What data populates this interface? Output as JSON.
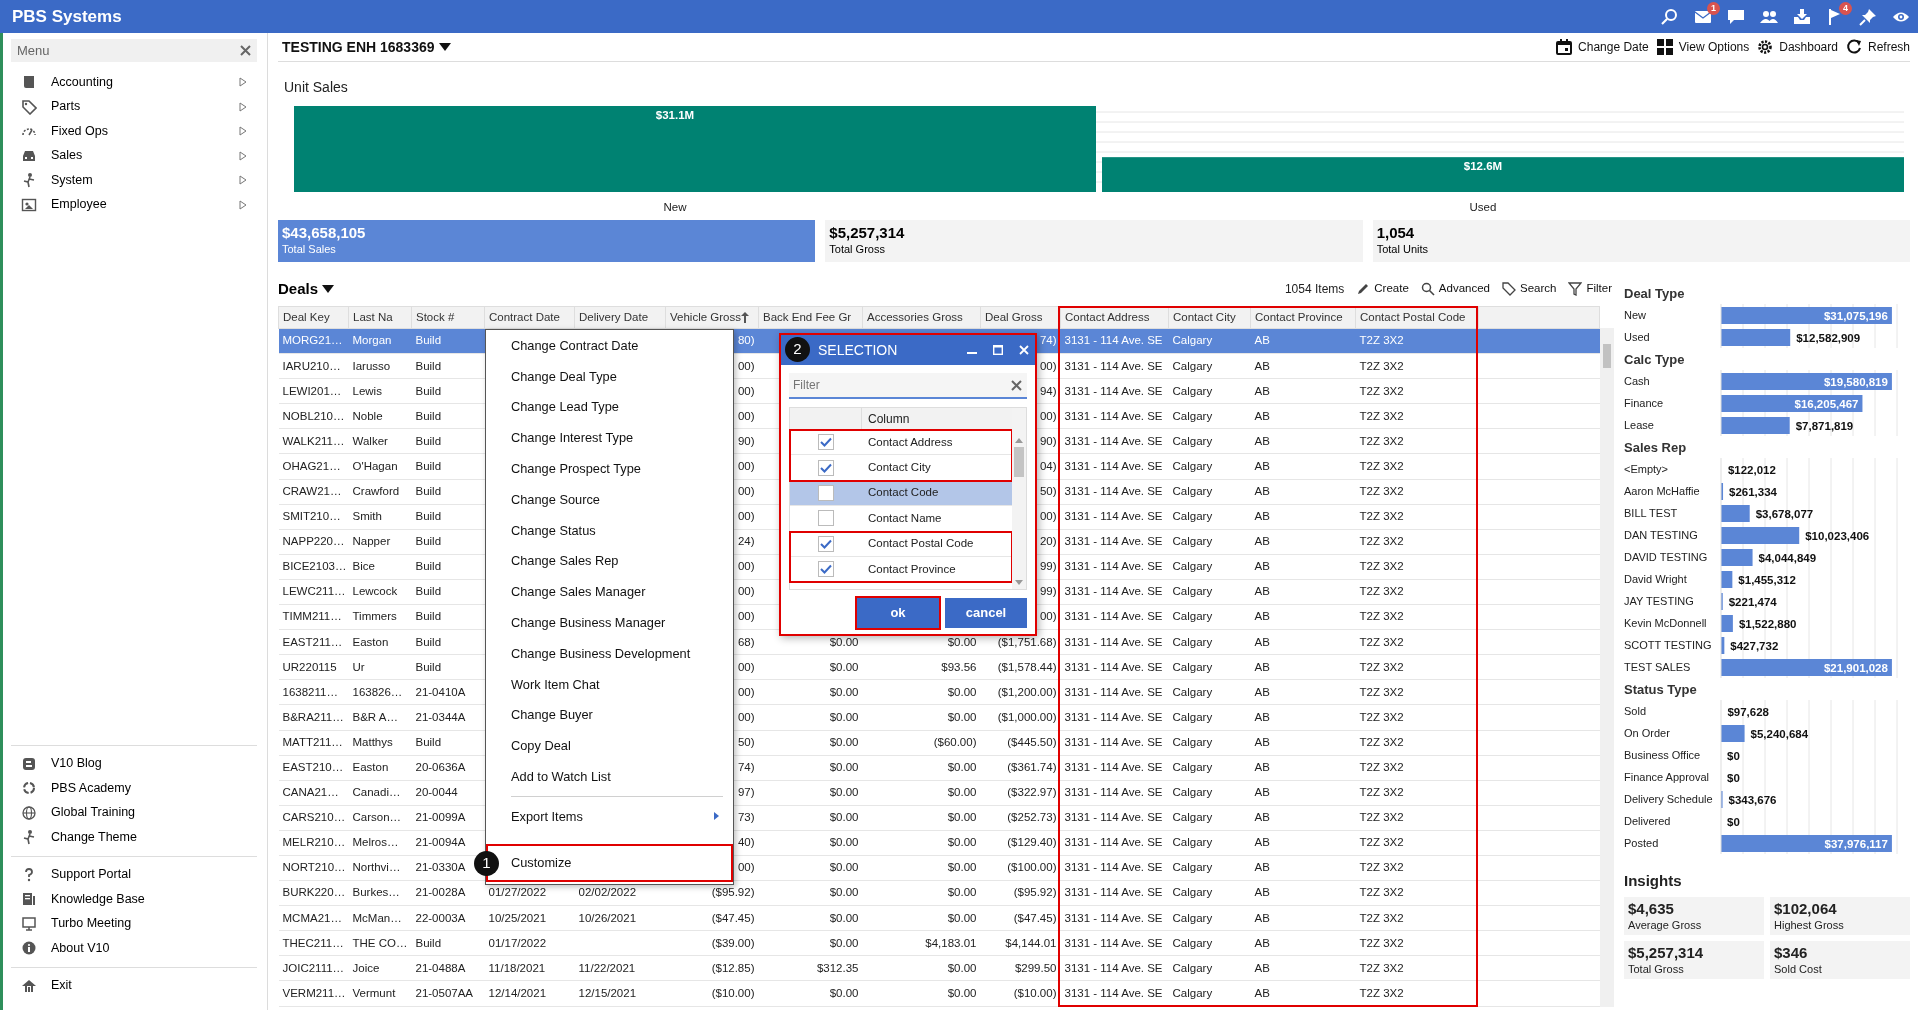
{
  "app": {
    "title": "PBS Systems",
    "mail_badge": "1",
    "flag_badge": "4"
  },
  "sidebar": {
    "header": "Menu",
    "items": [
      {
        "label": "Accounting"
      },
      {
        "label": "Parts"
      },
      {
        "label": "Fixed Ops"
      },
      {
        "label": "Sales"
      },
      {
        "label": "System"
      },
      {
        "label": "Employee"
      }
    ],
    "link_groups": [
      [
        "V10 Blog",
        "PBS Academy",
        "Global Training",
        "Change Theme"
      ],
      [
        "Support Portal",
        "Knowledge Base",
        "Turbo Meeting",
        "About V10"
      ],
      [
        "Exit"
      ]
    ]
  },
  "toolbar": {
    "title": "TESTING ENH 1683369",
    "actions": [
      "Change Date",
      "View Options",
      "Dashboard",
      "Refresh"
    ]
  },
  "unit_sales": {
    "title": "Unit Sales",
    "chart_data": {
      "type": "bar",
      "categories": [
        "New",
        "Used"
      ],
      "values": [
        31.1,
        12.6
      ],
      "value_labels": [
        "$31.1M",
        "$12.6M"
      ],
      "color": "#008272"
    }
  },
  "summary_tiles": [
    {
      "value": "$43,658,105",
      "label": "Total Sales",
      "selected": true
    },
    {
      "value": "$5,257,314",
      "label": "Total Gross",
      "selected": false
    },
    {
      "value": "1,054",
      "label": "Total Units",
      "selected": false
    }
  ],
  "deals": {
    "title": "Deals",
    "count": "1054 Items",
    "actions": [
      "Create",
      "Advanced",
      "Search",
      "Filter"
    ],
    "columns": [
      {
        "label": "Deal Key",
        "sorted": false,
        "highlighted": false
      },
      {
        "label": "Last Na",
        "sorted": false,
        "highlighted": false
      },
      {
        "label": "Stock #",
        "sorted": false,
        "highlighted": false
      },
      {
        "label": "Contract Date",
        "sorted": false,
        "highlighted": false
      },
      {
        "label": "Delivery Date",
        "sorted": false,
        "highlighted": false
      },
      {
        "label": "Vehicle Gross",
        "sorted": true,
        "highlighted": false
      },
      {
        "label": "Back End Fee Gr",
        "sorted": false,
        "highlighted": false
      },
      {
        "label": "Accessories Gross",
        "sorted": false,
        "highlighted": false
      },
      {
        "label": "Deal Gross",
        "sorted": false,
        "highlighted": false
      },
      {
        "label": "Contact Address",
        "sorted": false,
        "highlighted": true
      },
      {
        "label": "Contact City",
        "sorted": false,
        "highlighted": true
      },
      {
        "label": "Contact Province",
        "sorted": false,
        "highlighted": true
      },
      {
        "label": "Contact Postal Code",
        "sorted": false,
        "highlighted": true
      }
    ],
    "rows": [
      {
        "selected": true,
        "cells": [
          "MORG21…",
          "Morgan",
          "Build",
          null,
          null,
          "80)",
          null,
          null,
          "74)",
          "3131 - 114 Ave. SE",
          "Calgary",
          "AB",
          "T2Z 3X2"
        ]
      },
      {
        "selected": false,
        "cells": [
          "IARU210…",
          "Iarusso",
          "Build",
          null,
          null,
          "00)",
          null,
          null,
          "00)",
          "3131 - 114 Ave. SE",
          "Calgary",
          "AB",
          "T2Z 3X2"
        ]
      },
      {
        "selected": false,
        "cells": [
          "LEWI201…",
          "Lewis",
          "Build",
          null,
          null,
          "00)",
          null,
          null,
          "94)",
          "3131 - 114 Ave. SE",
          "Calgary",
          "AB",
          "T2Z 3X2"
        ]
      },
      {
        "selected": false,
        "cells": [
          "NOBL210…",
          "Noble",
          "Build",
          null,
          null,
          "00)",
          null,
          null,
          "00)",
          "3131 - 114 Ave. SE",
          "Calgary",
          "AB",
          "T2Z 3X2"
        ]
      },
      {
        "selected": false,
        "cells": [
          "WALK211…",
          "Walker",
          "Build",
          null,
          null,
          "90)",
          null,
          null,
          "90)",
          "3131 - 114 Ave. SE",
          "Calgary",
          "AB",
          "T2Z 3X2"
        ]
      },
      {
        "selected": false,
        "cells": [
          "OHAG21…",
          "O'Hagan",
          "Build",
          null,
          null,
          "00)",
          null,
          null,
          "04)",
          "3131 - 114 Ave. SE",
          "Calgary",
          "AB",
          "T2Z 3X2"
        ]
      },
      {
        "selected": false,
        "cells": [
          "CRAW21…",
          "Crawford",
          "Build",
          null,
          null,
          "00)",
          null,
          null,
          "50)",
          "3131 - 114 Ave. SE",
          "Calgary",
          "AB",
          "T2Z 3X2"
        ]
      },
      {
        "selected": false,
        "cells": [
          "SMIT210…",
          "Smith",
          "Build",
          null,
          null,
          "00)",
          null,
          null,
          "00)",
          "3131 - 114 Ave. SE",
          "Calgary",
          "AB",
          "T2Z 3X2"
        ]
      },
      {
        "selected": false,
        "cells": [
          "NAPP220…",
          "Napper",
          "Build",
          null,
          null,
          "24)",
          null,
          null,
          "20)",
          "3131 - 114 Ave. SE",
          "Calgary",
          "AB",
          "T2Z 3X2"
        ]
      },
      {
        "selected": false,
        "cells": [
          "BICE2103…",
          "Bice",
          "Build",
          null,
          null,
          "00)",
          null,
          null,
          "99)",
          "3131 - 114 Ave. SE",
          "Calgary",
          "AB",
          "T2Z 3X2"
        ]
      },
      {
        "selected": false,
        "cells": [
          "LEWC211…",
          "Lewcock",
          "Build",
          null,
          null,
          "00)",
          null,
          null,
          "99)",
          "3131 - 114 Ave. SE",
          "Calgary",
          "AB",
          "T2Z 3X2"
        ]
      },
      {
        "selected": false,
        "cells": [
          "TIMM211…",
          "Timmers",
          "Build",
          null,
          null,
          "00)",
          null,
          null,
          "00)",
          "3131 - 114 Ave. SE",
          "Calgary",
          "AB",
          "T2Z 3X2"
        ]
      },
      {
        "selected": false,
        "cells": [
          "EAST211…",
          "Easton",
          "Build",
          null,
          null,
          "68)",
          "$0.00",
          "$0.00",
          "($1,751.68)",
          "3131 - 114 Ave. SE",
          "Calgary",
          "AB",
          "T2Z 3X2"
        ]
      },
      {
        "selected": false,
        "cells": [
          "UR220115",
          "Ur",
          "Build",
          null,
          null,
          "00)",
          "$0.00",
          "$93.56",
          "($1,578.44)",
          "3131 - 114 Ave. SE",
          "Calgary",
          "AB",
          "T2Z 3X2"
        ]
      },
      {
        "selected": false,
        "cells": [
          "1638211…",
          "163826…",
          "21-0410A",
          null,
          null,
          "00)",
          "$0.00",
          "$0.00",
          "($1,200.00)",
          "3131 - 114 Ave. SE",
          "Calgary",
          "AB",
          "T2Z 3X2"
        ]
      },
      {
        "selected": false,
        "cells": [
          "B&RA211…",
          "B&R A…",
          "21-0344A",
          null,
          null,
          "00)",
          "$0.00",
          "$0.00",
          "($1,000.00)",
          "3131 - 114 Ave. SE",
          "Calgary",
          "AB",
          "T2Z 3X2"
        ]
      },
      {
        "selected": false,
        "cells": [
          "MATT211…",
          "Matthys",
          "Build",
          null,
          null,
          "50)",
          "$0.00",
          "($60.00)",
          "($445.50)",
          "3131 - 114 Ave. SE",
          "Calgary",
          "AB",
          "T2Z 3X2"
        ]
      },
      {
        "selected": false,
        "cells": [
          "EAST210…",
          "Easton",
          "20-0636A",
          null,
          null,
          "74)",
          "$0.00",
          "$0.00",
          "($361.74)",
          "3131 - 114 Ave. SE",
          "Calgary",
          "AB",
          "T2Z 3X2"
        ]
      },
      {
        "selected": false,
        "cells": [
          "CANA21…",
          "Canadi…",
          "20-0044",
          null,
          null,
          "97)",
          "$0.00",
          "$0.00",
          "($322.97)",
          "3131 - 114 Ave. SE",
          "Calgary",
          "AB",
          "T2Z 3X2"
        ]
      },
      {
        "selected": false,
        "cells": [
          "CARS210…",
          "Carson…",
          "21-0099A",
          null,
          null,
          "73)",
          "$0.00",
          "$0.00",
          "($252.73)",
          "3131 - 114 Ave. SE",
          "Calgary",
          "AB",
          "T2Z 3X2"
        ]
      },
      {
        "selected": false,
        "cells": [
          "MELR210…",
          "Melros…",
          "21-0094A",
          null,
          null,
          "40)",
          "$0.00",
          "$0.00",
          "($129.40)",
          "3131 - 114 Ave. SE",
          "Calgary",
          "AB",
          "T2Z 3X2"
        ]
      },
      {
        "selected": false,
        "cells": [
          "NORT210…",
          "Northvi…",
          "21-0330A",
          null,
          null,
          "00)",
          "$0.00",
          "$0.00",
          "($100.00)",
          "3131 - 114 Ave. SE",
          "Calgary",
          "AB",
          "T2Z 3X2"
        ]
      },
      {
        "selected": false,
        "cells": [
          "BURK220…",
          "Burkes…",
          "21-0028A",
          "01/27/2022",
          "02/02/2022",
          "($95.92)",
          "$0.00",
          "$0.00",
          "($95.92)",
          "3131 - 114 Ave. SE",
          "Calgary",
          "AB",
          "T2Z 3X2"
        ]
      },
      {
        "selected": false,
        "cells": [
          "MCMA21…",
          "McMan…",
          "22-0003A",
          "10/25/2021",
          "10/26/2021",
          "($47.45)",
          "$0.00",
          "$0.00",
          "($47.45)",
          "3131 - 114 Ave. SE",
          "Calgary",
          "AB",
          "T2Z 3X2"
        ]
      },
      {
        "selected": false,
        "cells": [
          "THEC211…",
          "THE CO…",
          "Build",
          "01/17/2022",
          null,
          "($39.00)",
          "$0.00",
          "$4,183.01",
          "$4,144.01",
          "3131 - 114 Ave. SE",
          "Calgary",
          "AB",
          "T2Z 3X2"
        ]
      },
      {
        "selected": false,
        "cells": [
          "JOIC2111…",
          "Joice",
          "21-0488A",
          "11/18/2021",
          "11/22/2021",
          "($12.85)",
          "$312.35",
          "$0.00",
          "$299.50",
          "3131 - 114 Ave. SE",
          "Calgary",
          "AB",
          "T2Z 3X2"
        ]
      },
      {
        "selected": false,
        "cells": [
          "VERM211…",
          "Vermunt",
          "21-0507AA",
          "12/14/2021",
          "12/15/2021",
          "($10.00)",
          "$0.00",
          "$0.00",
          "($10.00)",
          "3131 - 114 Ave. SE",
          "Calgary",
          "AB",
          "T2Z 3X2"
        ]
      }
    ]
  },
  "context_menu": {
    "items": [
      {
        "label": "Change Contract Date",
        "kind": "item",
        "highlighted": false
      },
      {
        "label": "Change Deal Type",
        "kind": "item",
        "highlighted": false
      },
      {
        "label": "Change Lead Type",
        "kind": "item",
        "highlighted": false
      },
      {
        "label": "Change Interest Type",
        "kind": "item",
        "highlighted": false
      },
      {
        "label": "Change Prospect Type",
        "kind": "item",
        "highlighted": false
      },
      {
        "label": "Change Source",
        "kind": "item",
        "highlighted": false
      },
      {
        "label": "Change Status",
        "kind": "item",
        "highlighted": false
      },
      {
        "label": "Change Sales Rep",
        "kind": "item",
        "highlighted": false
      },
      {
        "label": "Change Sales Manager",
        "kind": "item",
        "highlighted": false
      },
      {
        "label": "Change Business Manager",
        "kind": "item",
        "highlighted": false
      },
      {
        "label": "Change Business Development",
        "kind": "item",
        "highlighted": false
      },
      {
        "label": "Work Item Chat",
        "kind": "item",
        "highlighted": false
      },
      {
        "label": "Change Buyer",
        "kind": "item",
        "highlighted": false
      },
      {
        "label": "Copy Deal",
        "kind": "item",
        "highlighted": false
      },
      {
        "label": "Add to Watch List",
        "kind": "item",
        "highlighted": false
      },
      {
        "kind": "separator"
      },
      {
        "label": "Export Items",
        "kind": "submenu",
        "highlighted": false
      },
      {
        "label": "Customize",
        "kind": "item",
        "highlighted": true,
        "marker": "1"
      }
    ]
  },
  "selection_dialog": {
    "title": "SELECTION",
    "marker": "2",
    "highlighted": true,
    "filter_placeholder": "Filter",
    "column_header": "Column",
    "rows": [
      {
        "label": "Contact Address",
        "checked": true,
        "selected": false,
        "highlighted": true
      },
      {
        "label": "Contact City",
        "checked": true,
        "selected": false,
        "highlighted": true
      },
      {
        "label": "Contact Code",
        "checked": false,
        "selected": true,
        "highlighted": false
      },
      {
        "label": "Contact Name",
        "checked": false,
        "selected": false,
        "highlighted": false
      },
      {
        "label": "Contact Postal Code",
        "checked": true,
        "selected": false,
        "highlighted": true
      },
      {
        "label": "Contact Province",
        "checked": true,
        "selected": false,
        "highlighted": true
      }
    ],
    "buttons": [
      {
        "label": "ok",
        "highlighted": true
      },
      {
        "label": "cancel",
        "highlighted": false
      }
    ]
  },
  "right_panel": {
    "groups": [
      {
        "title": "Deal Type",
        "chart_data": {
          "type": "bar",
          "orientation": "horizontal",
          "categories": [
            "New",
            "Used"
          ],
          "values": [
            31075196,
            12582909
          ],
          "value_labels": [
            "$31,075,196",
            "$12,582,909"
          ]
        }
      },
      {
        "title": "Calc Type",
        "chart_data": {
          "type": "bar",
          "orientation": "horizontal",
          "categories": [
            "Cash",
            "Finance",
            "Lease"
          ],
          "values": [
            19580819,
            16205467,
            7871819
          ],
          "value_labels": [
            "$19,580,819",
            "$16,205,467",
            "$7,871,819"
          ]
        }
      },
      {
        "title": "Sales Rep",
        "chart_data": {
          "type": "bar",
          "orientation": "horizontal",
          "categories": [
            "<Empty>",
            "Aaron McHaffie",
            "BILL TEST",
            "DAN TESTING",
            "DAVID TESTING",
            "David Wright",
            "JAY TESTING",
            "Kevin McDonnell",
            "SCOTT TESTING",
            "TEST SALES"
          ],
          "values": [
            122012,
            261334,
            3678077,
            10023406,
            4044849,
            1455312,
            221474,
            1522880,
            427732,
            21901028
          ],
          "value_labels": [
            "$122,012",
            "$261,334",
            "$3,678,077",
            "$10,023,406",
            "$4,044,849",
            "$1,455,312",
            "$221,474",
            "$1,522,880",
            "$427,732",
            "$21,901,028"
          ]
        }
      },
      {
        "title": "Status Type",
        "chart_data": {
          "type": "bar",
          "orientation": "horizontal",
          "categories": [
            "Sold",
            "On Order",
            "Business Office",
            "Finance Approval",
            "Delivery Schedule",
            "Delivered",
            "Posted"
          ],
          "values": [
            97628,
            5240684,
            0,
            0,
            343676,
            0,
            37976117
          ],
          "value_labels": [
            "$97,628",
            "$5,240,684",
            "$0",
            "$0",
            "$343,676",
            "$0",
            "$37,976,117"
          ]
        }
      }
    ],
    "insights": {
      "title": "Insights",
      "tiles": [
        {
          "value": "$4,635",
          "label": "Average Gross"
        },
        {
          "value": "$102,064",
          "label": "Highest Gross"
        },
        {
          "value": "$5,257,314",
          "label": "Total Gross"
        },
        {
          "value": "$346",
          "label": "Sold Cost"
        }
      ]
    }
  }
}
